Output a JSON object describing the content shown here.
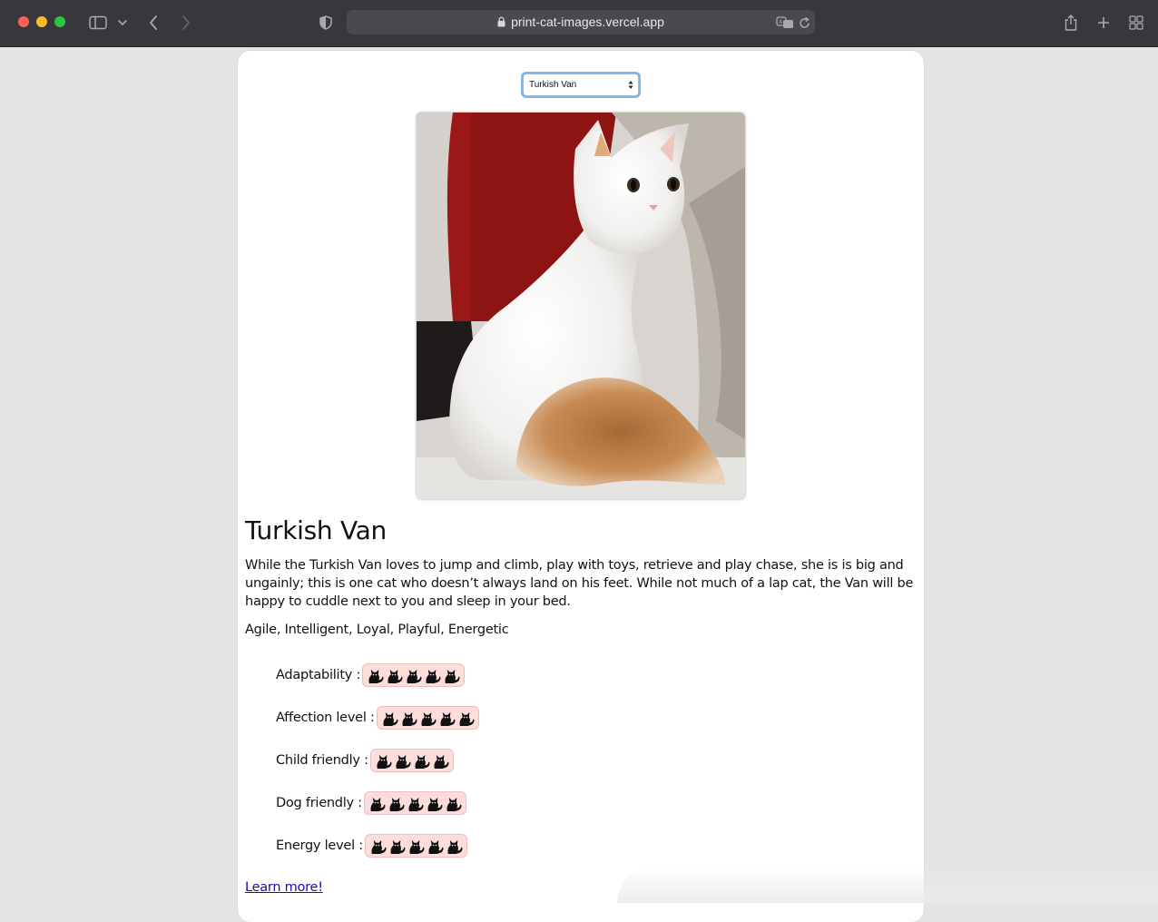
{
  "browser": {
    "url": "print-cat-images.vercel.app"
  },
  "breed_select": {
    "selected": "Turkish Van"
  },
  "breed": {
    "name": "Turkish Van",
    "description": "While the Turkish Van loves to jump and climb, play with toys, retrieve and play chase, she is is big and ungainly; this is one cat who doesn’t always land on his feet. While not much of a lap cat, the Van will be happy to cuddle next to you and sleep in your bed.",
    "temperament": "Agile, Intelligent, Loyal, Playful, Energetic",
    "stats": [
      {
        "label": "Adaptability :",
        "rating": 5
      },
      {
        "label": "Affection level :",
        "rating": 5
      },
      {
        "label": "Child friendly :",
        "rating": 4
      },
      {
        "label": "Dog friendly :",
        "rating": 5
      },
      {
        "label": "Energy level :",
        "rating": 5
      }
    ],
    "learn_more": "Learn more!"
  },
  "colors": {
    "rating_bg": "#fddcdc",
    "link": "#1a0dab",
    "chrome": "#38373c"
  }
}
